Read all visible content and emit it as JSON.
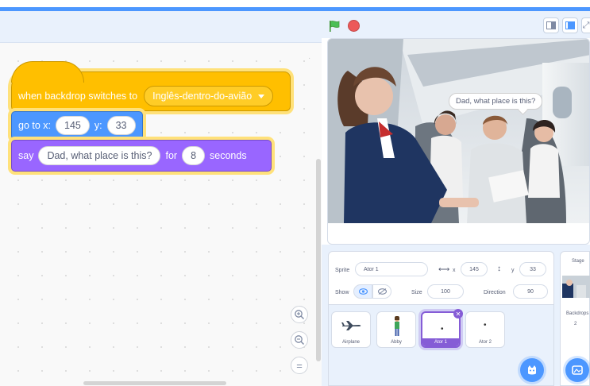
{
  "code": {
    "hat_block": {
      "text": "when backdrop switches to",
      "backdrop": "Inglês-dentro-do-avião"
    },
    "motion_block": {
      "goto_label": "go to x:",
      "x": "145",
      "y_label": "y:",
      "y": "33"
    },
    "looks_block": {
      "say_label": "say",
      "message": "Dad, what place is this?",
      "for_label": "for",
      "seconds": "8",
      "seconds_label": "seconds"
    },
    "zoom": {
      "in": "+",
      "out": "−",
      "reset": "="
    }
  },
  "stage": {
    "speech_bubble": "Dad, what place is this?"
  },
  "sprite_info": {
    "sprite_label": "Sprite",
    "sprite_name": "Ator 1",
    "x_label": "x",
    "x_value": "145",
    "y_label": "y",
    "y_value": "33",
    "show_label": "Show",
    "size_label": "Size",
    "size_value": "100",
    "direction_label": "Direction",
    "direction_value": "90"
  },
  "sprites": [
    {
      "name": "Airplane"
    },
    {
      "name": "Abby"
    },
    {
      "name": "Ator 1"
    },
    {
      "name": "Ator 2"
    }
  ],
  "stage_panel": {
    "title": "Stage",
    "backdrops_label": "Backdrops",
    "backdrops_count": "2"
  },
  "colors": {
    "events": "#FFBF00",
    "motion": "#4C97FF",
    "looks": "#9966FF",
    "selected": "#855CD6"
  }
}
